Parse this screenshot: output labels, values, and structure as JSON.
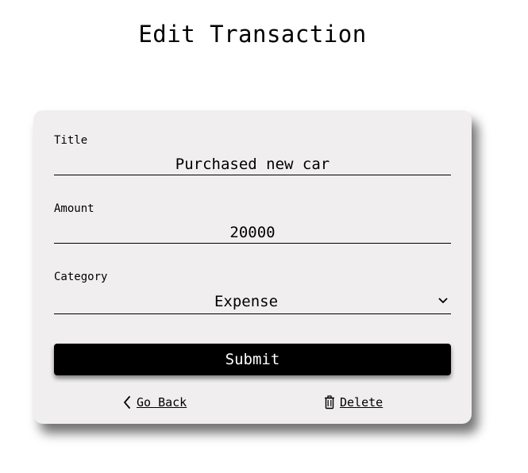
{
  "header": {
    "title": "Edit Transaction"
  },
  "form": {
    "title": {
      "label": "Title",
      "value": "Purchased new car"
    },
    "amount": {
      "label": "Amount",
      "value": "20000"
    },
    "category": {
      "label": "Category",
      "selected": "Expense",
      "icon": "chevron-down-icon"
    },
    "submit_label": "Submit"
  },
  "actions": {
    "go_back": {
      "label": "Go Back",
      "icon": "chevron-left-icon"
    },
    "delete": {
      "label": "Delete",
      "icon": "trash-icon"
    }
  },
  "colors": {
    "card_background": "#f0eeee",
    "button_background": "#000000",
    "button_text": "#ffffff"
  }
}
